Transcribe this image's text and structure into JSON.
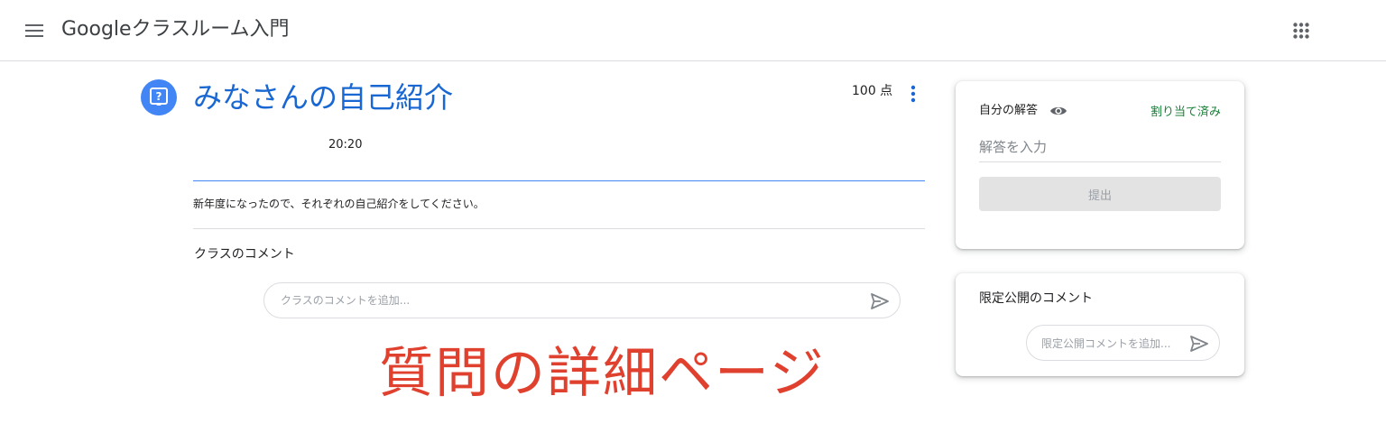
{
  "header": {
    "menu_icon": "hamburger-menu-icon",
    "class_title": "Googleクラスルーム入門",
    "apps_icon": "apps-grid-icon"
  },
  "question": {
    "icon": "question-assignment-icon",
    "title": "みなさんの自己紹介",
    "points": "100 点",
    "more_icon": "more-vert-icon",
    "due_time": "20:20",
    "instructions": "新年度になったので、それぞれの自己紹介をしてください。",
    "accent_color": "#1967d2"
  },
  "class_comments": {
    "heading": "クラスのコメント",
    "placeholder": "クラスのコメントを追加...",
    "send_icon": "send-icon"
  },
  "your_work": {
    "heading": "自分の解答",
    "visibility_icon": "eye-icon",
    "status": "割り当て済み",
    "status_color": "#188038",
    "answer_placeholder": "解答を入力",
    "submit_label": "提出"
  },
  "private_comments": {
    "heading": "限定公開のコメント",
    "placeholder": "限定公開コメントを追加...",
    "send_icon": "send-icon"
  },
  "caption": {
    "text": "質問の詳細ページ",
    "color": "#e0412f"
  }
}
